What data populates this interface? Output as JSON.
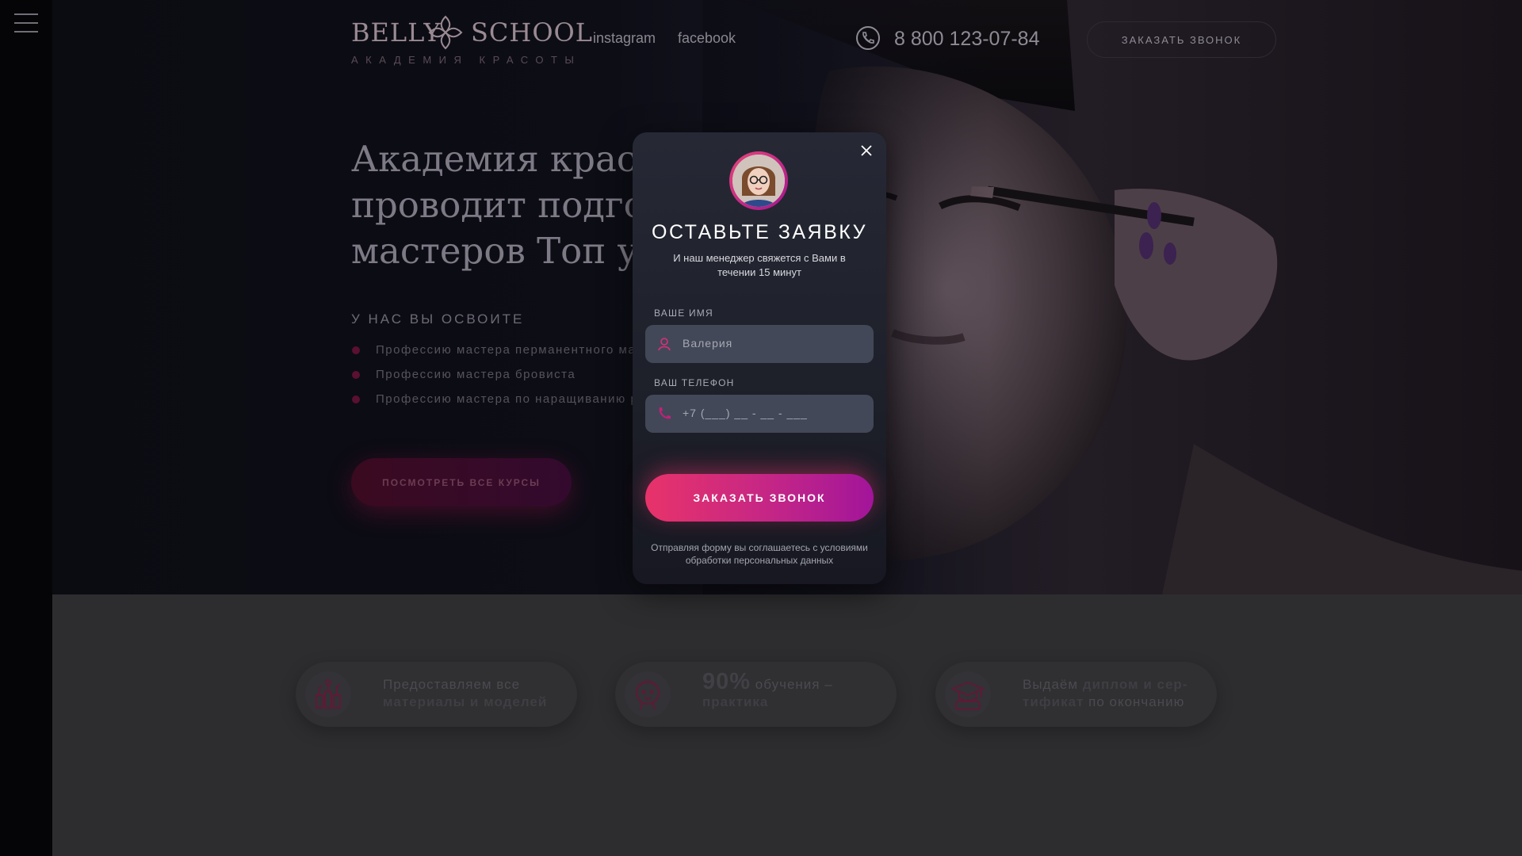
{
  "header": {
    "logo_left": "BELLY",
    "logo_right": "SCHOOL",
    "logo_sub": "АКАДЕМИЯ КРАСОТЫ",
    "social": [
      "instagram",
      "facebook"
    ],
    "phone": "8 800 123-07-84",
    "call_button": "ЗАКАЗАТЬ ЗВОНОК"
  },
  "hero": {
    "title_lines": [
      "Академия красоты",
      "проводит подгото",
      "мастеров Топ уро"
    ],
    "learn_heading": "У НАС ВЫ ОСВОИТЕ",
    "learn_items": [
      "Профессию мастера перманентного макияжа",
      "Профессию мастера бровиста",
      "Профессию мастера по наращиванию ресниц"
    ],
    "courses_button": "ПОСМОТРЕТЬ ВСЕ КУРСЫ"
  },
  "features": [
    {
      "icon": "makeup-kit-icon",
      "line1": "Предоставляем все",
      "line2_bold": "материалы и моделей"
    },
    {
      "icon": "face-icon",
      "big": "90%",
      "line1_rest": " обучения –",
      "line2_bold": "практика"
    },
    {
      "icon": "graduation-cap-icon",
      "line1_pre": "Выдаём ",
      "line1_bold": "диплом и сер-",
      "line2_bold": "тификат",
      "line2_rest": " по окончанию"
    }
  ],
  "modal": {
    "title": "ОСТАВЬТЕ ЗАЯВКУ",
    "subtitle": "И наш менеджер свяжется с Вами в течении 15 минут",
    "name_label": "ВАШЕ ИМЯ",
    "name_value": "Валерия",
    "phone_label": "ВАШ ТЕЛЕФОН",
    "phone_placeholder": "+7 (___) __ - __ - ___",
    "submit": "ЗАКАЗАТЬ ЗВОНОК",
    "terms": "Отправляя форму вы соглашаетесь с условиями обработки персональных данных"
  },
  "colors": {
    "accent_start": "#e8336a",
    "accent_end": "#a2159a",
    "modal_bg": "#1d1f29",
    "field_bg": "#434858",
    "band_bg": "#2d2d2f"
  }
}
